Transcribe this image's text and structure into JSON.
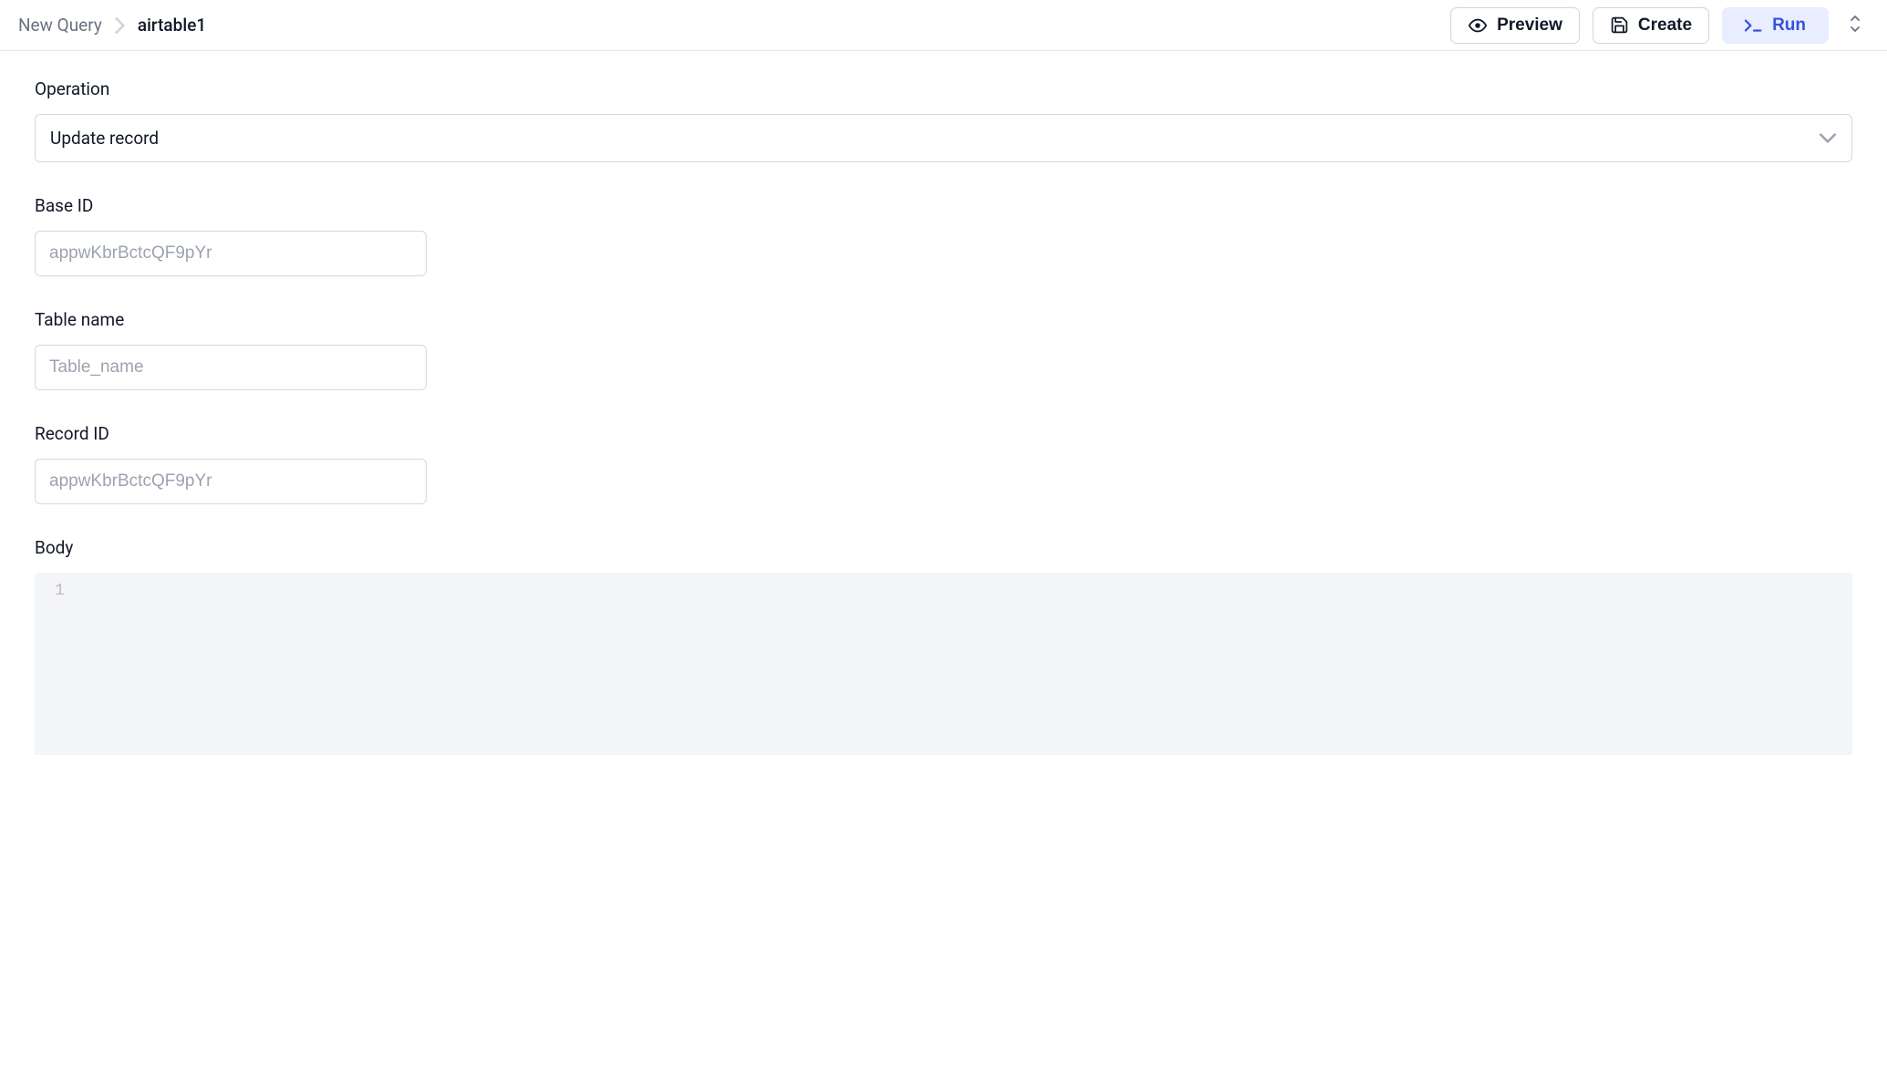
{
  "breadcrumb": {
    "root": "New Query",
    "current": "airtable1"
  },
  "actions": {
    "preview": "Preview",
    "create": "Create",
    "run": "Run"
  },
  "form": {
    "operation_label": "Operation",
    "operation_value": "Update record",
    "base_id_label": "Base ID",
    "base_id_placeholder": "appwKbrBctcQF9pYr",
    "base_id_value": "",
    "table_name_label": "Table name",
    "table_name_placeholder": "Table_name",
    "table_name_value": "",
    "record_id_label": "Record ID",
    "record_id_placeholder": "appwKbrBctcQF9pYr",
    "record_id_value": "",
    "body_label": "Body",
    "body_line_number": "1",
    "body_content": ""
  }
}
